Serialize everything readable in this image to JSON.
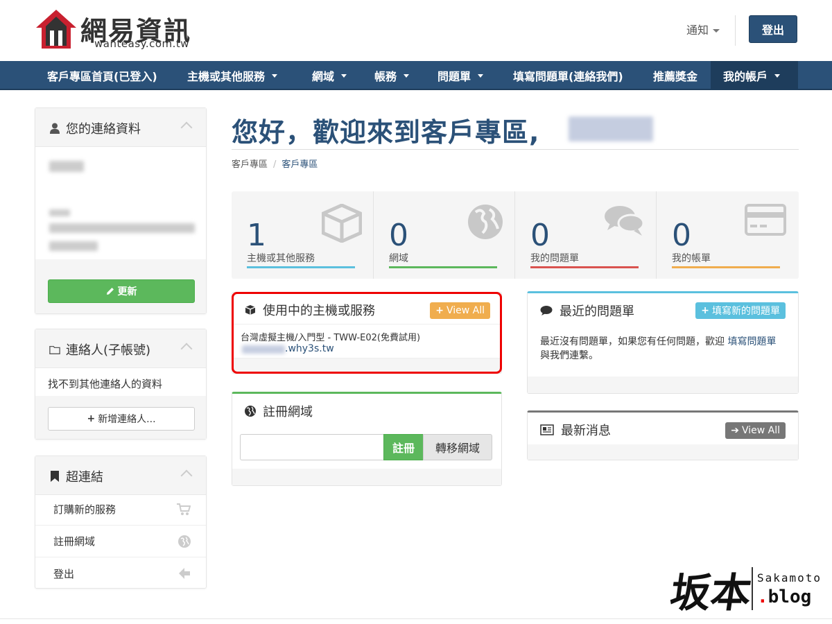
{
  "header": {
    "logo_title": "網易資訊",
    "logo_sub": "wanteasy.com.tw",
    "notify_label": "通知",
    "logout_label": "登出"
  },
  "nav": {
    "items": [
      {
        "label": "客戶專區首頁(已登入)",
        "dropdown": false
      },
      {
        "label": "主機或其他服務",
        "dropdown": true
      },
      {
        "label": "網域",
        "dropdown": true
      },
      {
        "label": "帳務",
        "dropdown": true
      },
      {
        "label": "問題單",
        "dropdown": true
      },
      {
        "label": "填寫問題單(連絡我們)",
        "dropdown": false
      },
      {
        "label": "推薦獎金",
        "dropdown": false
      },
      {
        "label": "我的帳戶",
        "dropdown": true
      }
    ]
  },
  "sidebar": {
    "contact": {
      "title": "您的連絡資料",
      "update_label": "更新"
    },
    "subaccounts": {
      "title": "連絡人(子帳號)",
      "empty_text": "找不到其他連絡人的資料",
      "add_label": "新增連絡人..."
    },
    "links": {
      "title": "超連結",
      "items": [
        {
          "label": "訂購新的服務",
          "icon": "cart-icon"
        },
        {
          "label": "註冊網域",
          "icon": "globe-icon"
        },
        {
          "label": "登出",
          "icon": "arrow-left-icon"
        }
      ]
    }
  },
  "main": {
    "welcome": "您好，歡迎來到客戶專區,",
    "breadcrumb": [
      "客戶專區",
      "客戶專區"
    ],
    "stats": [
      {
        "value": "1",
        "label": "主機或其他服務",
        "color": "#5bc0de",
        "icon": "cube-icon"
      },
      {
        "value": "0",
        "label": "網域",
        "color": "#5cb85c",
        "icon": "globe-icon"
      },
      {
        "value": "0",
        "label": "我的問題單",
        "color": "#d9534f",
        "icon": "comments-icon"
      },
      {
        "value": "0",
        "label": "我的帳單",
        "color": "#f0ad4e",
        "icon": "credit-card-icon"
      }
    ],
    "services": {
      "title": "使用中的主機或服務",
      "view_all": "View All",
      "item_name": "台灣虛擬主機/入門型 - TWW-E02(免費試用)",
      "item_domain": ".why3s.tw"
    },
    "domain_register": {
      "title": "註冊網域",
      "register_label": "註冊",
      "transfer_label": "轉移網域"
    },
    "tickets": {
      "title": "最近的問題單",
      "new_label": "填寫新的問題單",
      "body_prefix": "最近沒有問題單，如果您有任何問題，歡迎",
      "body_link": "填寫問題單",
      "body_suffix": "與我們連繫。"
    },
    "news": {
      "title": "最新消息",
      "view_all": "View All"
    }
  },
  "watermark": {
    "cn": "坂本",
    "en1": "Sakamoto",
    "en2": ".blog"
  },
  "colors": {
    "primary": "#2b5178",
    "success": "#5cb85c",
    "info": "#5bc0de",
    "warning": "#f0ad4e",
    "danger": "#d9534f",
    "highlight": "#e00000"
  }
}
